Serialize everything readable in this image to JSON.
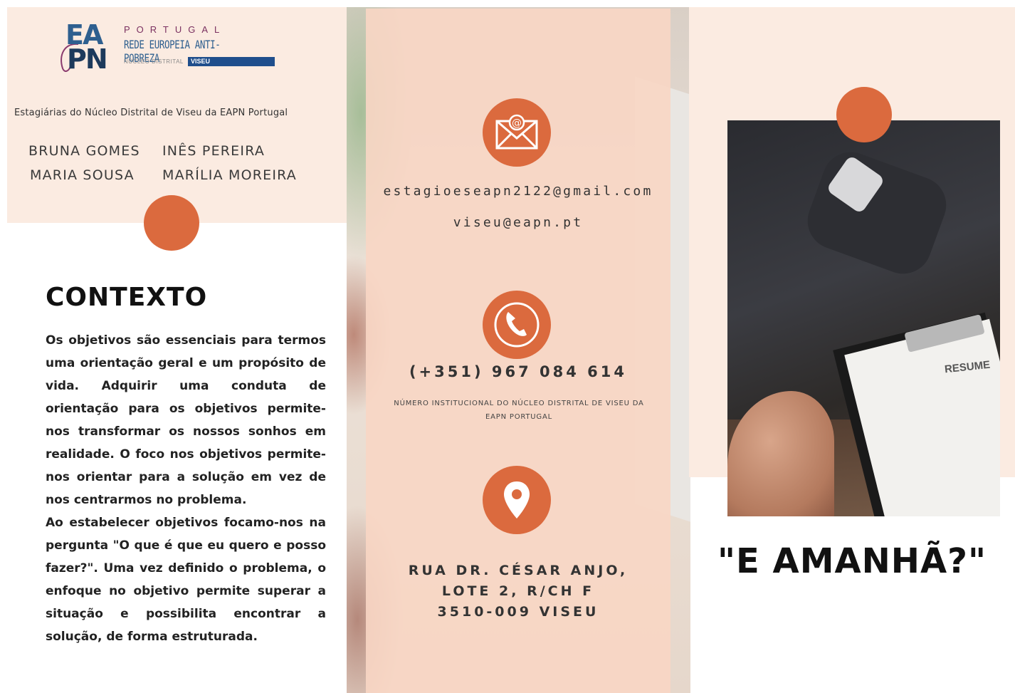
{
  "left": {
    "logo": {
      "letters_top": "EA",
      "letters_bottom": "PN",
      "country": "PORTUGAL",
      "network": "REDE EUROPEIA ANTI-POBREZA",
      "nucleo": "NÚCLEO DISTRITAL",
      "district": "VISEU"
    },
    "interns_label": "Estagiárias do Núcleo Distrital de Viseu da EAPN Portugal",
    "names": [
      "BRUNA GOMES",
      "INÊS PEREIRA",
      "MARIA SOUSA",
      "MARÍLIA MOREIRA"
    ],
    "context_title": "CONTEXTO",
    "context_p1": "Os objetivos são essenciais para termos uma orientação geral e um propósito de vida. Adquirir uma conduta de orientação para os objetivos permite-nos transformar os nossos sonhos em realidade. O foco nos objetivos permite-nos orientar para a solução em vez de nos centrarmos no problema.",
    "context_p2": "Ao estabelecer objetivos focamo-nos na pergunta \"O que é que eu quero e posso fazer?\". Uma vez definido o problema, o enfoque no objetivo permite superar a situação e possibilita encontrar a solução, de forma estruturada."
  },
  "middle": {
    "email_icon": "envelope-at-icon",
    "emails": [
      "estagioeseapn2122@gmail.com",
      "viseu@eapn.pt"
    ],
    "phone_icon": "phone-icon",
    "phone": "(+351) 967 084 614",
    "phone_note": "NÚMERO INSTITUCIONAL DO NÚCLEO DISTRITAL DE VISEU DA EAPN PORTUGAL",
    "location_icon": "location-pin-icon",
    "address_lines": [
      "RUA DR. CÉSAR ANJO,",
      "LOTE 2, R/CH F",
      "3510-009 VISEU"
    ]
  },
  "right": {
    "photo_text": "RESUME",
    "headline": "\"E AMANHÃ?\""
  },
  "colors": {
    "accent": "#db6a3e",
    "peach": "#fbebe1",
    "panel": "#f8d6c4"
  }
}
